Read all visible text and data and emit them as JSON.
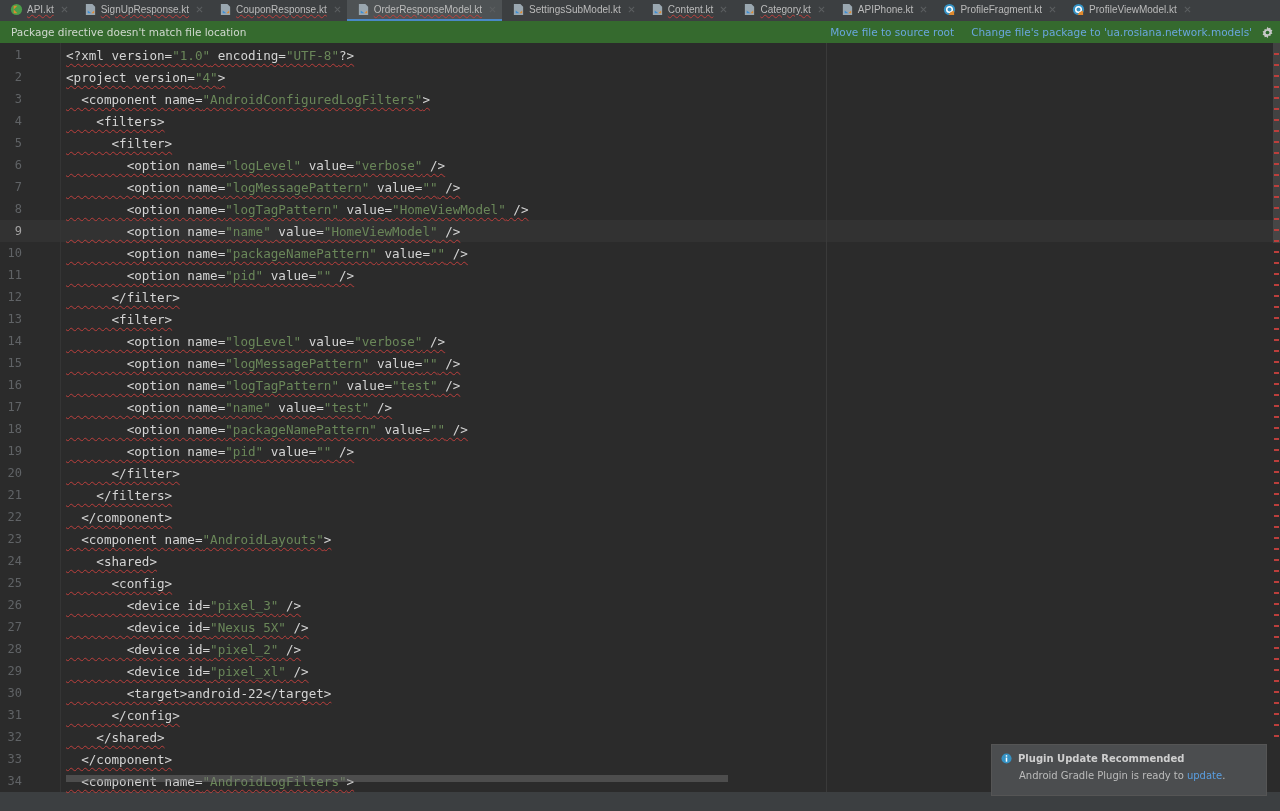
{
  "tabs": [
    {
      "label": "API.kt",
      "kind": "kotlin",
      "selected": false,
      "error": true
    },
    {
      "label": "SignUpResponse.kt",
      "kind": "file",
      "selected": false,
      "error": true
    },
    {
      "label": "CouponResponse.kt",
      "kind": "file",
      "selected": false,
      "error": true
    },
    {
      "label": "OrderResponseModel.kt",
      "kind": "file",
      "selected": true,
      "error": true
    },
    {
      "label": "SettingsSubModel.kt",
      "kind": "file",
      "selected": false,
      "error": false
    },
    {
      "label": "Content.kt",
      "kind": "file",
      "selected": false,
      "error": true
    },
    {
      "label": "Category.kt",
      "kind": "file",
      "selected": false,
      "error": true
    },
    {
      "label": "APIPhone.kt",
      "kind": "file",
      "selected": false,
      "error": false
    },
    {
      "label": "ProfileFragment.kt",
      "kind": "class",
      "selected": false,
      "error": false
    },
    {
      "label": "ProfileViewModel.kt",
      "kind": "class",
      "selected": false,
      "error": false
    }
  ],
  "banner": {
    "message": "Package directive doesn't match file location",
    "actions": [
      "Move file to source root",
      "Change file's package to 'ua.rosiana.network.models'"
    ]
  },
  "editor": {
    "lines": [
      {
        "number": "1",
        "current": false,
        "tokens": [
          {
            "kind": "markup",
            "text": "<?xml version="
          },
          {
            "kind": "string",
            "text": "\"1.0\""
          },
          {
            "kind": "markup",
            "text": " encoding="
          },
          {
            "kind": "string",
            "text": "\"UTF-8\""
          },
          {
            "kind": "markup",
            "text": "?>"
          }
        ]
      },
      {
        "number": "2",
        "current": false,
        "tokens": [
          {
            "kind": "markup",
            "text": "<project version="
          },
          {
            "kind": "string",
            "text": "\"4\""
          },
          {
            "kind": "markup",
            "text": ">"
          }
        ]
      },
      {
        "number": "3",
        "current": false,
        "tokens": [
          {
            "kind": "markup",
            "text": "  <component name="
          },
          {
            "kind": "string",
            "text": "\"AndroidConfiguredLogFilters\""
          },
          {
            "kind": "markup",
            "text": ">"
          }
        ]
      },
      {
        "number": "4",
        "current": false,
        "tokens": [
          {
            "kind": "markup",
            "text": "    <filters>"
          }
        ]
      },
      {
        "number": "5",
        "current": false,
        "tokens": [
          {
            "kind": "markup",
            "text": "      <filter>"
          }
        ]
      },
      {
        "number": "6",
        "current": false,
        "tokens": [
          {
            "kind": "markup",
            "text": "        <option name="
          },
          {
            "kind": "string",
            "text": "\"logLevel\""
          },
          {
            "kind": "markup",
            "text": " value="
          },
          {
            "kind": "string",
            "text": "\"verbose\""
          },
          {
            "kind": "markup",
            "text": " />"
          }
        ]
      },
      {
        "number": "7",
        "current": false,
        "tokens": [
          {
            "kind": "markup",
            "text": "        <option name="
          },
          {
            "kind": "string",
            "text": "\"logMessagePattern\""
          },
          {
            "kind": "markup",
            "text": " value="
          },
          {
            "kind": "string",
            "text": "\"\""
          },
          {
            "kind": "markup",
            "text": " />"
          }
        ]
      },
      {
        "number": "8",
        "current": false,
        "tokens": [
          {
            "kind": "markup",
            "text": "        <option name="
          },
          {
            "kind": "string",
            "text": "\"logTagPattern\""
          },
          {
            "kind": "markup",
            "text": " value="
          },
          {
            "kind": "string",
            "text": "\"HomeViewModel\""
          },
          {
            "kind": "markup",
            "text": " />"
          }
        ]
      },
      {
        "number": "9",
        "current": true,
        "tokens": [
          {
            "kind": "markup",
            "text": "        <option name="
          },
          {
            "kind": "string",
            "text": "\"name\""
          },
          {
            "kind": "markup",
            "text": " value="
          },
          {
            "kind": "string",
            "text": "\"HomeViewModel\""
          },
          {
            "kind": "markup",
            "text": " />"
          }
        ]
      },
      {
        "number": "10",
        "current": false,
        "tokens": [
          {
            "kind": "markup",
            "text": "        <option name="
          },
          {
            "kind": "string",
            "text": "\"packageNamePattern\""
          },
          {
            "kind": "markup",
            "text": " value="
          },
          {
            "kind": "string",
            "text": "\"\""
          },
          {
            "kind": "markup",
            "text": " />"
          }
        ]
      },
      {
        "number": "11",
        "current": false,
        "tokens": [
          {
            "kind": "markup",
            "text": "        <option name="
          },
          {
            "kind": "string",
            "text": "\"pid\""
          },
          {
            "kind": "markup",
            "text": " value="
          },
          {
            "kind": "string",
            "text": "\"\""
          },
          {
            "kind": "markup",
            "text": " />"
          }
        ]
      },
      {
        "number": "12",
        "current": false,
        "tokens": [
          {
            "kind": "markup",
            "text": "      </filter>"
          }
        ]
      },
      {
        "number": "13",
        "current": false,
        "tokens": [
          {
            "kind": "markup",
            "text": "      <filter>"
          }
        ]
      },
      {
        "number": "14",
        "current": false,
        "tokens": [
          {
            "kind": "markup",
            "text": "        <option name="
          },
          {
            "kind": "string",
            "text": "\"logLevel\""
          },
          {
            "kind": "markup",
            "text": " value="
          },
          {
            "kind": "string",
            "text": "\"verbose\""
          },
          {
            "kind": "markup",
            "text": " />"
          }
        ]
      },
      {
        "number": "15",
        "current": false,
        "tokens": [
          {
            "kind": "markup",
            "text": "        <option name="
          },
          {
            "kind": "string",
            "text": "\"logMessagePattern\""
          },
          {
            "kind": "markup",
            "text": " value="
          },
          {
            "kind": "string",
            "text": "\"\""
          },
          {
            "kind": "markup",
            "text": " />"
          }
        ]
      },
      {
        "number": "16",
        "current": false,
        "tokens": [
          {
            "kind": "markup",
            "text": "        <option name="
          },
          {
            "kind": "string",
            "text": "\"logTagPattern\""
          },
          {
            "kind": "markup",
            "text": " value="
          },
          {
            "kind": "string",
            "text": "\"test\""
          },
          {
            "kind": "markup",
            "text": " />"
          }
        ]
      },
      {
        "number": "17",
        "current": false,
        "tokens": [
          {
            "kind": "markup",
            "text": "        <option name="
          },
          {
            "kind": "string",
            "text": "\"name\""
          },
          {
            "kind": "markup",
            "text": " value="
          },
          {
            "kind": "string",
            "text": "\"test\""
          },
          {
            "kind": "markup",
            "text": " />"
          }
        ]
      },
      {
        "number": "18",
        "current": false,
        "tokens": [
          {
            "kind": "markup",
            "text": "        <option name="
          },
          {
            "kind": "string",
            "text": "\"packageNamePattern\""
          },
          {
            "kind": "markup",
            "text": " value="
          },
          {
            "kind": "string",
            "text": "\"\""
          },
          {
            "kind": "markup",
            "text": " />"
          }
        ]
      },
      {
        "number": "19",
        "current": false,
        "tokens": [
          {
            "kind": "markup",
            "text": "        <option name="
          },
          {
            "kind": "string",
            "text": "\"pid\""
          },
          {
            "kind": "markup",
            "text": " value="
          },
          {
            "kind": "string",
            "text": "\"\""
          },
          {
            "kind": "markup",
            "text": " />"
          }
        ]
      },
      {
        "number": "20",
        "current": false,
        "tokens": [
          {
            "kind": "markup",
            "text": "      </filter>"
          }
        ]
      },
      {
        "number": "21",
        "current": false,
        "tokens": [
          {
            "kind": "markup",
            "text": "    </filters>"
          }
        ]
      },
      {
        "number": "22",
        "current": false,
        "tokens": [
          {
            "kind": "markup",
            "text": "  </component>"
          }
        ]
      },
      {
        "number": "23",
        "current": false,
        "tokens": [
          {
            "kind": "markup",
            "text": "  <component name="
          },
          {
            "kind": "string",
            "text": "\"AndroidLayouts\""
          },
          {
            "kind": "markup",
            "text": ">"
          }
        ]
      },
      {
        "number": "24",
        "current": false,
        "tokens": [
          {
            "kind": "markup",
            "text": "    <shared>"
          }
        ]
      },
      {
        "number": "25",
        "current": false,
        "tokens": [
          {
            "kind": "markup",
            "text": "      <config>"
          }
        ]
      },
      {
        "number": "26",
        "current": false,
        "tokens": [
          {
            "kind": "markup",
            "text": "        <device id="
          },
          {
            "kind": "string",
            "text": "\"pixel_3\""
          },
          {
            "kind": "markup",
            "text": " />"
          }
        ]
      },
      {
        "number": "27",
        "current": false,
        "tokens": [
          {
            "kind": "markup",
            "text": "        <device id="
          },
          {
            "kind": "string",
            "text": "\"Nexus 5X\""
          },
          {
            "kind": "markup",
            "text": " />"
          }
        ]
      },
      {
        "number": "28",
        "current": false,
        "tokens": [
          {
            "kind": "markup",
            "text": "        <device id="
          },
          {
            "kind": "string",
            "text": "\"pixel_2\""
          },
          {
            "kind": "markup",
            "text": " />"
          }
        ]
      },
      {
        "number": "29",
        "current": false,
        "tokens": [
          {
            "kind": "markup",
            "text": "        <device id="
          },
          {
            "kind": "string",
            "text": "\"pixel_xl\""
          },
          {
            "kind": "markup",
            "text": " />"
          }
        ]
      },
      {
        "number": "30",
        "current": false,
        "tokens": [
          {
            "kind": "markup",
            "text": "        <target>android-22</target>"
          }
        ]
      },
      {
        "number": "31",
        "current": false,
        "tokens": [
          {
            "kind": "markup",
            "text": "      </config>"
          }
        ]
      },
      {
        "number": "32",
        "current": false,
        "tokens": [
          {
            "kind": "markup",
            "text": "    </shared>"
          }
        ]
      },
      {
        "number": "33",
        "current": false,
        "tokens": [
          {
            "kind": "markup",
            "text": "  </component>"
          }
        ]
      },
      {
        "number": "34",
        "current": false,
        "tokens": [
          {
            "kind": "markup",
            "text": "  <component name="
          },
          {
            "kind": "string",
            "text": "\"AndroidLogFilters\""
          },
          {
            "kind": "markup",
            "text": ">"
          }
        ]
      }
    ]
  },
  "notification": {
    "title": "Plugin Update Recommended",
    "body": "Android Gradle Plugin is ready to",
    "link": "update",
    "suffix": "."
  }
}
